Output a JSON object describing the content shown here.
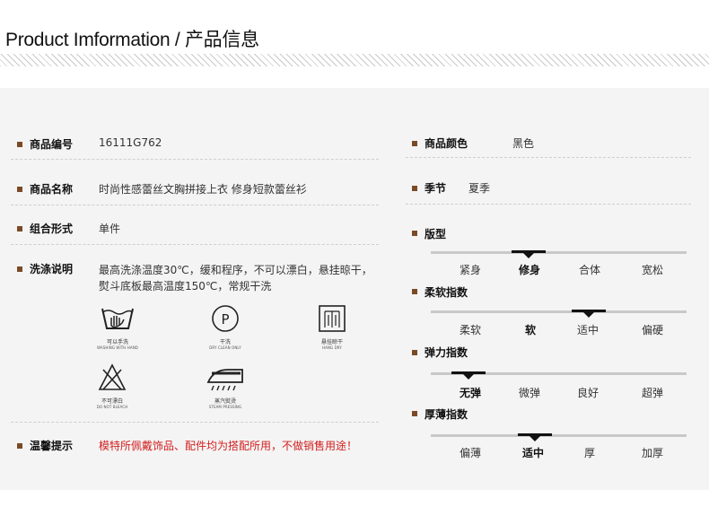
{
  "header": {
    "title": "Product Imformation / 产品信息"
  },
  "left": {
    "sku": {
      "label": "商品编号",
      "value": "16111G762"
    },
    "name": {
      "label": "商品名称",
      "value": "时尚性感蕾丝文胸拼接上衣 修身短款蕾丝衫"
    },
    "form": {
      "label": "组合形式",
      "value": "单件"
    },
    "wash": {
      "label": "洗涤说明",
      "line1": "最高洗涤温度30℃，缓和程序，不可以漂白，悬挂晾干，",
      "line2": "熨斗底板最高温度150℃，常规干洗"
    },
    "care_icons": [
      {
        "icon": "hand-wash-icon",
        "cn": "可以手洗",
        "en": "WASHING WITH HAND"
      },
      {
        "icon": "dry-clean-icon",
        "cn": "干洗",
        "en": "DRY CLEAN ONLY"
      },
      {
        "icon": "hang-dry-icon",
        "cn": "悬挂晾干",
        "en": "HANG DRY"
      },
      {
        "icon": "no-bleach-icon",
        "cn": "不可漂白",
        "en": "DO NOT BLEACH"
      },
      {
        "icon": "steam-iron-icon",
        "cn": "蒸汽熨烫",
        "en": "STEAM PRESSING"
      }
    ],
    "tip": {
      "label": "温馨提示",
      "value": "模特所佩戴饰品、配件均为搭配所用，不做销售用途！"
    }
  },
  "right": {
    "color": {
      "label": "商品颜色",
      "value": "黑色"
    },
    "season": {
      "label": "季节",
      "value": "夏季"
    },
    "fit": {
      "label": "版型",
      "options": [
        "紧身",
        "修身",
        "合体",
        "宽松"
      ],
      "selected_index": 1
    },
    "softness": {
      "label": "柔软指数",
      "options": [
        "柔软",
        "软",
        "适中",
        "偏硬"
      ],
      "selected_index": 2
    },
    "elasticity": {
      "label": "弹力指数",
      "options": [
        "无弹",
        "微弹",
        "良好",
        "超弹"
      ],
      "selected_index": 0
    },
    "thickness": {
      "label": "厚薄指数",
      "options": [
        "偏薄",
        "适中",
        "厚",
        "加厚"
      ],
      "selected_index": 1
    }
  },
  "colors": {
    "bullet": "#7a4a27",
    "tip_text": "#d21f1f",
    "panel": "#f4f4f4"
  }
}
